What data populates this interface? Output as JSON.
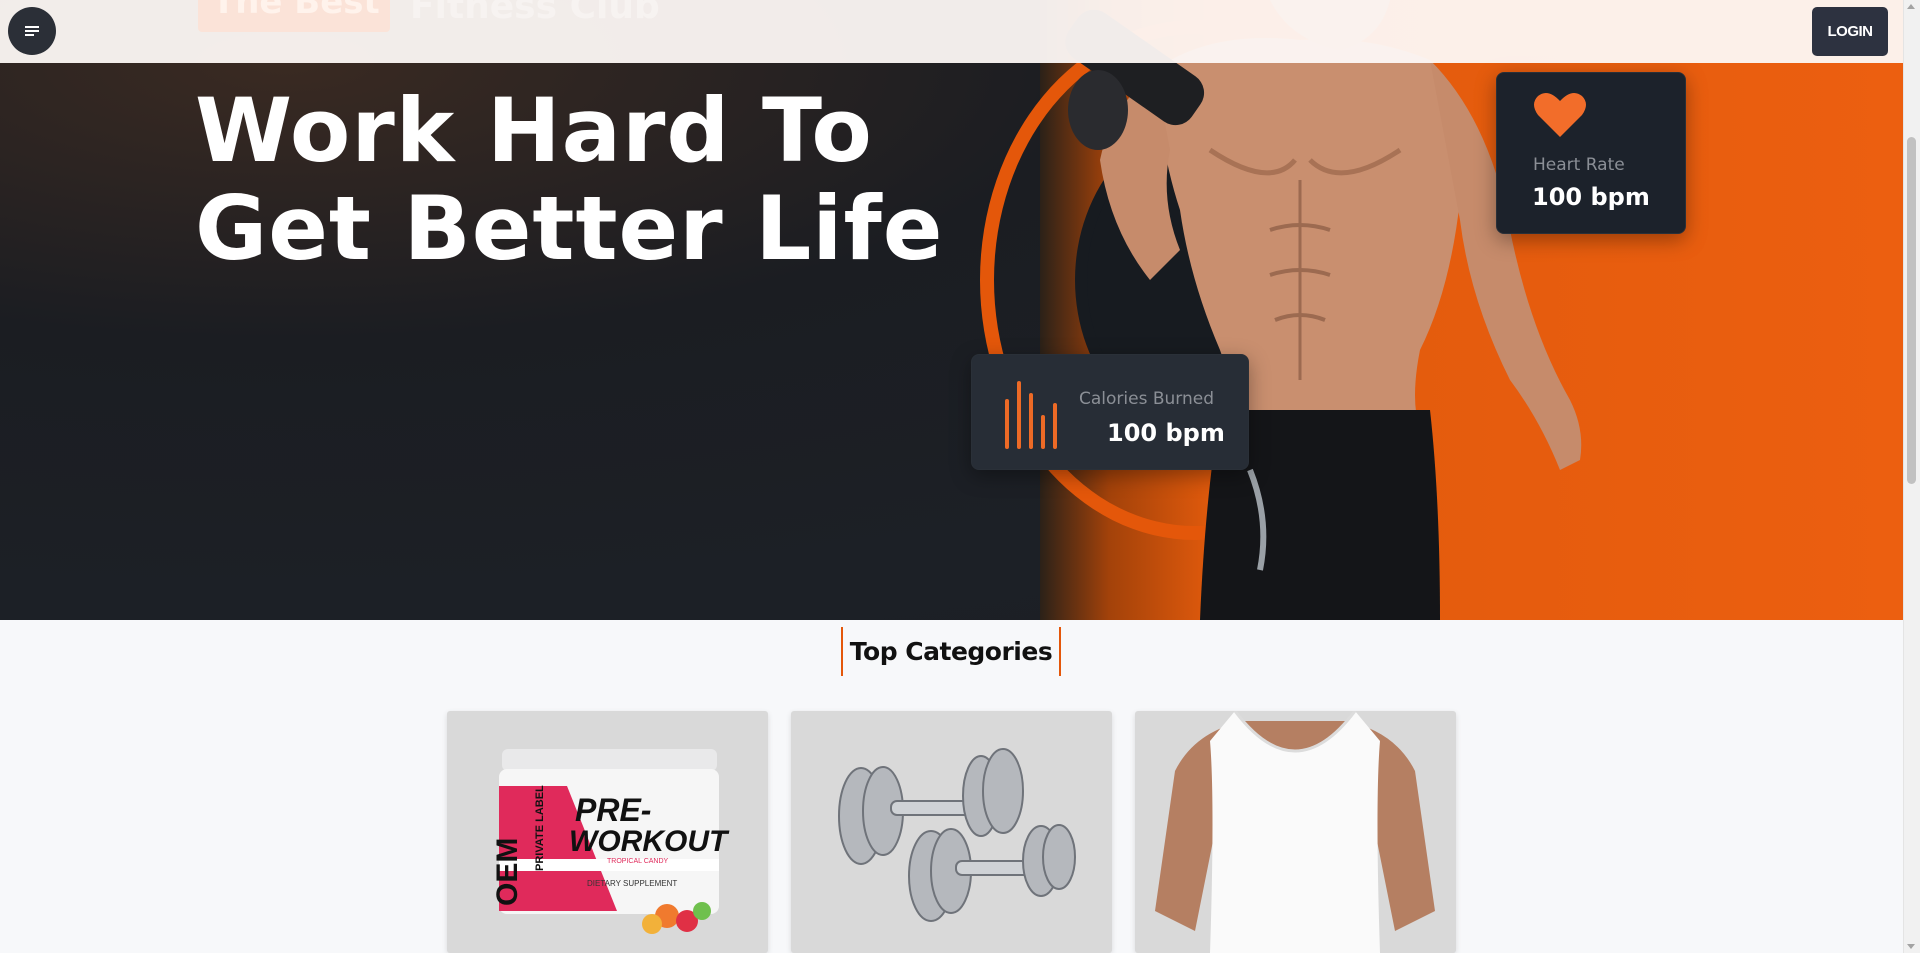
{
  "navbar": {
    "ghost_badge": "The Best",
    "ghost_text": "Fitness Club",
    "login_label": "LOGIN"
  },
  "hero": {
    "title_line1": "Work Hard To",
    "title_line2": "Get Better Life"
  },
  "stats": {
    "heart": {
      "label": "Heart Rate",
      "value": "100 bpm",
      "icon": "heart-icon"
    },
    "calories": {
      "label": "Calories Burned",
      "value": "100 bpm",
      "icon": "bar-chart-icon"
    }
  },
  "categories": {
    "title": "Top Categories",
    "items": [
      {
        "image": "pre-workout-supplement-jar",
        "jar_text_1": "PRE-",
        "jar_text_2": "WORKOUT",
        "jar_side_1": "OEM",
        "jar_side_2": "PRIVATE LABEL",
        "jar_sub": "TROPICAL CANDY",
        "jar_bottom": "DIETARY SUPPLEMENT"
      },
      {
        "image": "chrome-dumbbells"
      },
      {
        "image": "white-tank-top-model"
      }
    ]
  },
  "colors": {
    "accent": "#e4570a",
    "dark": "#1c222b",
    "login_bg": "#2d3240"
  }
}
